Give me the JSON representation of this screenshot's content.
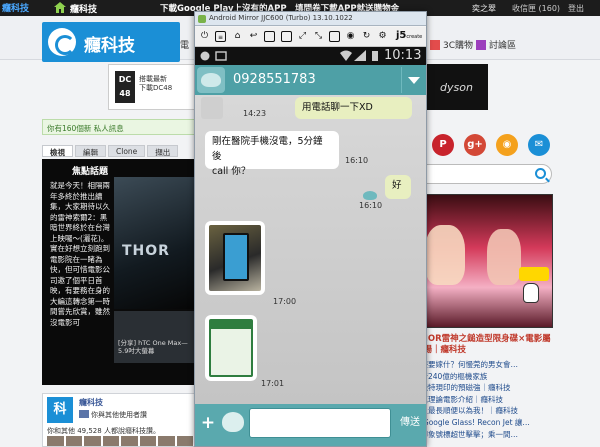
{
  "topbar": {
    "brand_left": "癮科技",
    "site_name": "癮科技",
    "promo": "下載Google Play上沒有的APP　填問卷下載APP就送購物金",
    "user": "奕之翠",
    "inbox": "收信匣 (160)",
    "logout": "登出"
  },
  "header": {
    "logo_text": "癮科技",
    "nav_fragment": "電",
    "nav_3c": "3C購物",
    "nav_forum": "討論區"
  },
  "ads": {
    "dc_box": "DC\n48",
    "dc_text": "搭載最新\n下載DC48",
    "dyson": "dyson"
  },
  "left": {
    "notice": "你有160個新 私人訊息",
    "tabs": [
      "檢視",
      "編輯",
      "Clone",
      "擷出"
    ],
    "focus_head": "焦點話題",
    "focus_body": "就是今天！相隔兩年多終於推出續集，大家期待以久的雷神索爾2：黑暗世界終於在台灣上映囉～(灑花)。實在好想立刻跑到電影院在一睹為快，但可惜電影公司邀了個平日首映，有要務在身的大編這轉念第一時間嘗先欣賞，雖然沒電影可",
    "thor_text": "THOR",
    "thumb_caption": "[分享] hTC One Max—5.9吋大螢幕"
  },
  "fanbox": {
    "logo_char": "科",
    "name": "癮科技",
    "like_label": "讚",
    "like_text": "你與其他使用者讚",
    "count_text": "你和其他 49,528 人都說癮科技讚。"
  },
  "social": [
    {
      "icon": "pinterest-icon",
      "glyph": "P",
      "color": "#c8232c"
    },
    {
      "icon": "google-plus-icon",
      "glyph": "g+",
      "color": "#d34836"
    },
    {
      "icon": "rss-icon",
      "glyph": "◉",
      "color": "#f4a11d"
    },
    {
      "icon": "mail-icon",
      "glyph": "✉",
      "color": "#1b8fd6"
    }
  ],
  "news": {
    "title": "諾！THOR雷神之鎚造型限身碟×電影屬強力登場｜癮科技",
    "items": [
      "大方撐慶要嫁什？何慢莞的男女會…",
      "文】最新240億的樞機家族",
      "體下戰機特現印的預磁強｜癮科技",
      "影表儀真理論電影介紹｜癮科技",
      "出世界上最長順便以為我！｜癮科技",
      "在分享 Google Glass! Recon Jet 讓…",
      "加計入印象號標超世擊擊；乘一間…"
    ]
  },
  "mirror": {
    "title": "Android Mirror JJC600 (Turbo) 13.10.1022",
    "toolbar_j5": "j5",
    "toolbar_j5_sub": "create",
    "clock": "10:13",
    "phone_number": "0928551783",
    "messages": [
      {
        "dir": "out",
        "text": "用電話聊一下XD",
        "time": "14:23"
      },
      {
        "dir": "in",
        "text": "剛在醫院手機沒電，5分鐘後\ncall 你？",
        "time": "16:10"
      },
      {
        "dir": "out",
        "text": "好",
        "time": "16:10"
      },
      {
        "dir": "in",
        "type": "image",
        "time": "17:00"
      },
      {
        "dir": "in",
        "type": "image",
        "time": "17:01"
      }
    ],
    "input_placeholder": "",
    "send_label": "傳送"
  }
}
